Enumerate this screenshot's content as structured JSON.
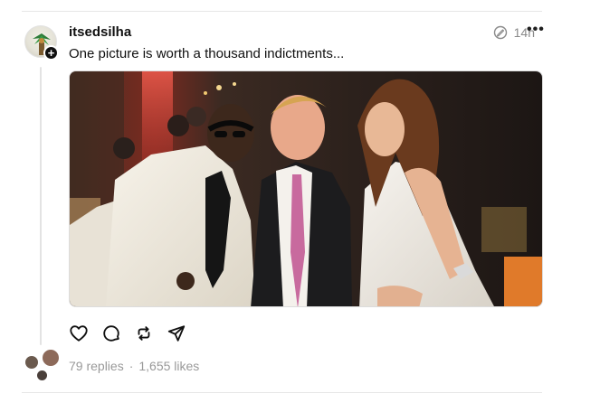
{
  "post": {
    "username": "itsedsilha",
    "time": "14h",
    "caption": "One picture is worth a thousand indictments...",
    "follow_symbol": "+",
    "more_symbol": "•••",
    "replies": "79 replies",
    "separator": "·",
    "likes": "1,655 likes"
  },
  "icons": {
    "like": "heart-icon",
    "reply": "comment-icon",
    "repost": "repost-icon",
    "share": "send-icon",
    "more": "more-icon",
    "verified": "edit-clock-icon"
  },
  "colors": {
    "text": "#101010",
    "muted": "#999999",
    "divider": "#e6e6e6"
  }
}
